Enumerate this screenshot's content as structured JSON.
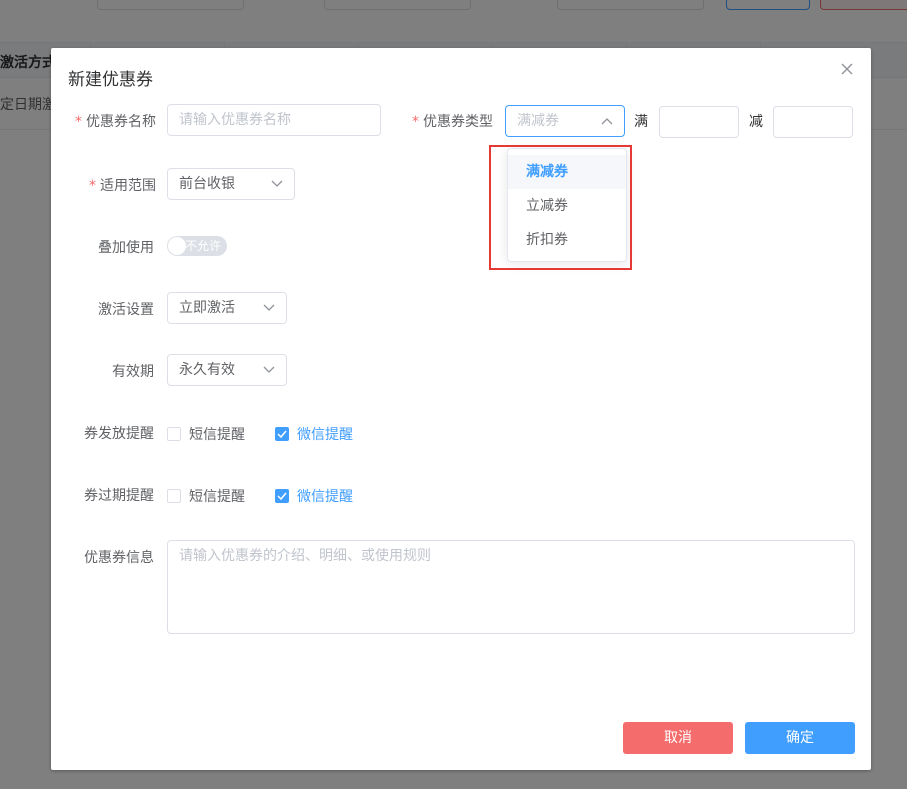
{
  "background": {
    "table_header_col": "激活方式",
    "table_row_col": "定日期激"
  },
  "dialog": {
    "title": "新建优惠券",
    "close_icon": "close-icon"
  },
  "form": {
    "coupon_name": {
      "label": "优惠券名称",
      "placeholder": "请输入优惠券名称"
    },
    "coupon_type": {
      "label": "优惠券类型",
      "selected": "满减券",
      "options": [
        "满减券",
        "立减券",
        "折扣券"
      ]
    },
    "full_label": "满",
    "minus_label": "减",
    "scope": {
      "label": "适用范围",
      "value": "前台收银"
    },
    "stack": {
      "label": "叠加使用",
      "switch_text": "不允许"
    },
    "activation": {
      "label": "激活设置",
      "value": "立即激活"
    },
    "validity": {
      "label": "有效期",
      "value": "永久有效"
    },
    "issue_reminder": {
      "label": "券发放提醒",
      "sms": "短信提醒",
      "wechat": "微信提醒"
    },
    "expire_reminder": {
      "label": "券过期提醒",
      "sms": "短信提醒",
      "wechat": "微信提醒"
    },
    "info": {
      "label": "优惠券信息",
      "placeholder": "请输入优惠券的介绍、明细、或使用规则"
    }
  },
  "buttons": {
    "cancel": "取消",
    "confirm": "确定"
  },
  "colors": {
    "primary": "#409eff",
    "danger": "#f56c6c",
    "highlight": "#e53935"
  }
}
